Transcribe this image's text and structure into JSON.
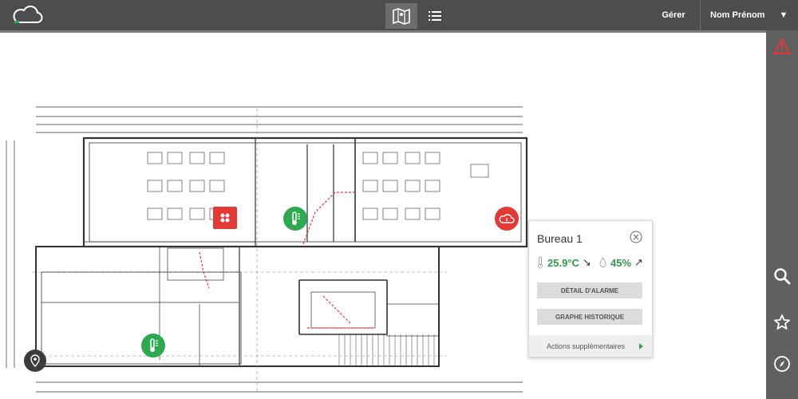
{
  "header": {
    "logo_icon": "cloud-icon",
    "views": [
      {
        "icon": "map-icon",
        "active": true
      },
      {
        "icon": "list-icon",
        "active": false
      }
    ],
    "manage_label": "Gérer",
    "user_label": "Nom Prénom"
  },
  "sidebar": {
    "icons": [
      "warning-icon",
      "search-icon",
      "star-icon",
      "compass-icon"
    ],
    "warning_color": "#e53935"
  },
  "colors": {
    "topbar": "#4b4d4f",
    "sidebar": "#5e6062",
    "ok": "#2daa4f",
    "alarm": "#e53935"
  },
  "floorplan": {
    "markers": [
      {
        "type": "thermometer",
        "status": "ok"
      },
      {
        "type": "thermometer",
        "status": "ok"
      },
      {
        "type": "cloud-alarm",
        "status": "alarm"
      },
      {
        "type": "alarm-sensor",
        "status": "alarm"
      }
    ]
  },
  "popup": {
    "title": "Bureau 1",
    "temperature": "25.9°C",
    "temperature_trend": "↘",
    "humidity": "45%",
    "humidity_trend": "↗",
    "alarm_detail_button": "Détail d'alarme",
    "history_button": "Graphe historique",
    "more_actions": "Actions supplémentaires"
  }
}
